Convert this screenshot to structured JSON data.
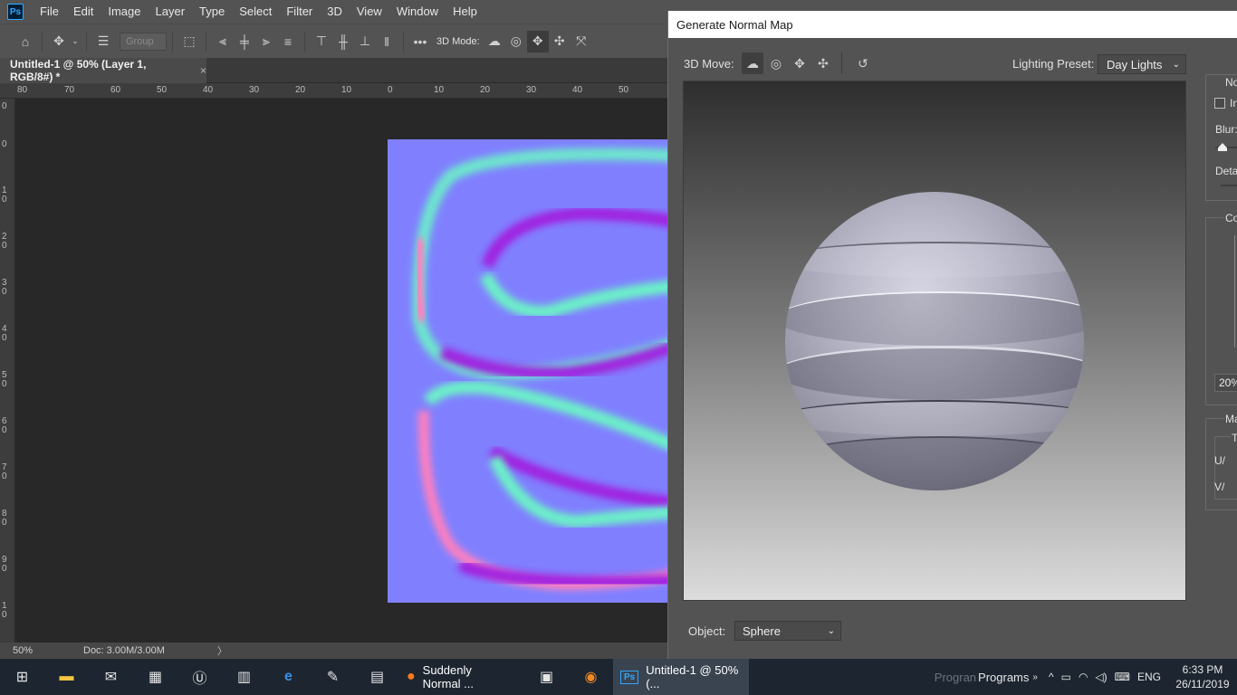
{
  "app": {
    "logo": "Ps"
  },
  "menu": [
    "File",
    "Edit",
    "Image",
    "Layer",
    "Type",
    "Select",
    "Filter",
    "3D",
    "View",
    "Window",
    "Help"
  ],
  "options_bar": {
    "group_placeholder": "Group",
    "mode_3d_label": "3D Mode:",
    "icons": [
      "home-icon",
      "move-tool-icon",
      "layers-stack-icon",
      "marquee-icon",
      "align-left-icon",
      "align-center-icon",
      "align-right-icon",
      "distribute-icon",
      "align-top-icon",
      "align-middle-icon",
      "align-bottom-icon",
      "more-icon",
      "orbit-icon",
      "roll-icon",
      "pan-icon",
      "slide-icon",
      "scale-icon"
    ]
  },
  "document_tab": {
    "title": "Untitled-1 @ 50% (Layer 1, RGB/8#) *",
    "close_glyph": "×"
  },
  "ruler": {
    "horizontal": [
      "80",
      "70",
      "60",
      "50",
      "40",
      "30",
      "20",
      "10",
      "0",
      "10",
      "20",
      "30",
      "40",
      "50"
    ],
    "vertical": [
      "0",
      "0",
      "1 0",
      "2 0",
      "3 0",
      "4 0",
      "5 0",
      "6 0",
      "7 0",
      "8 0",
      "9 0",
      "1 0"
    ]
  },
  "status_bar": {
    "zoom": "50%",
    "doc_size": "Doc: 3.00M/3.00M",
    "arrow": "〉"
  },
  "dialog": {
    "title": "Generate Normal Map",
    "move_label": "3D Move:",
    "lighting_label": "Lighting Preset:",
    "lighting_value": "Day Lights",
    "object_label": "Object:",
    "object_value": "Sphere",
    "right_panel": {
      "normal_group": "No",
      "invert_abbrev": "In",
      "blur_label": "Blur:",
      "detail_label": "Deta",
      "contrast_group": "Co",
      "percent_value": "20%",
      "map_group": "Ma",
      "t_label": "T",
      "u_label": "U/",
      "v_label": "V/"
    }
  },
  "taskbar": {
    "firefox_window": "Suddenly Normal ...",
    "ps_window": "Untitled-1 @ 50% (...",
    "programs_ghost": "Progran",
    "programs_label": "Programs",
    "language": "ENG",
    "time": "6:33 PM",
    "date": "26/11/2019"
  }
}
